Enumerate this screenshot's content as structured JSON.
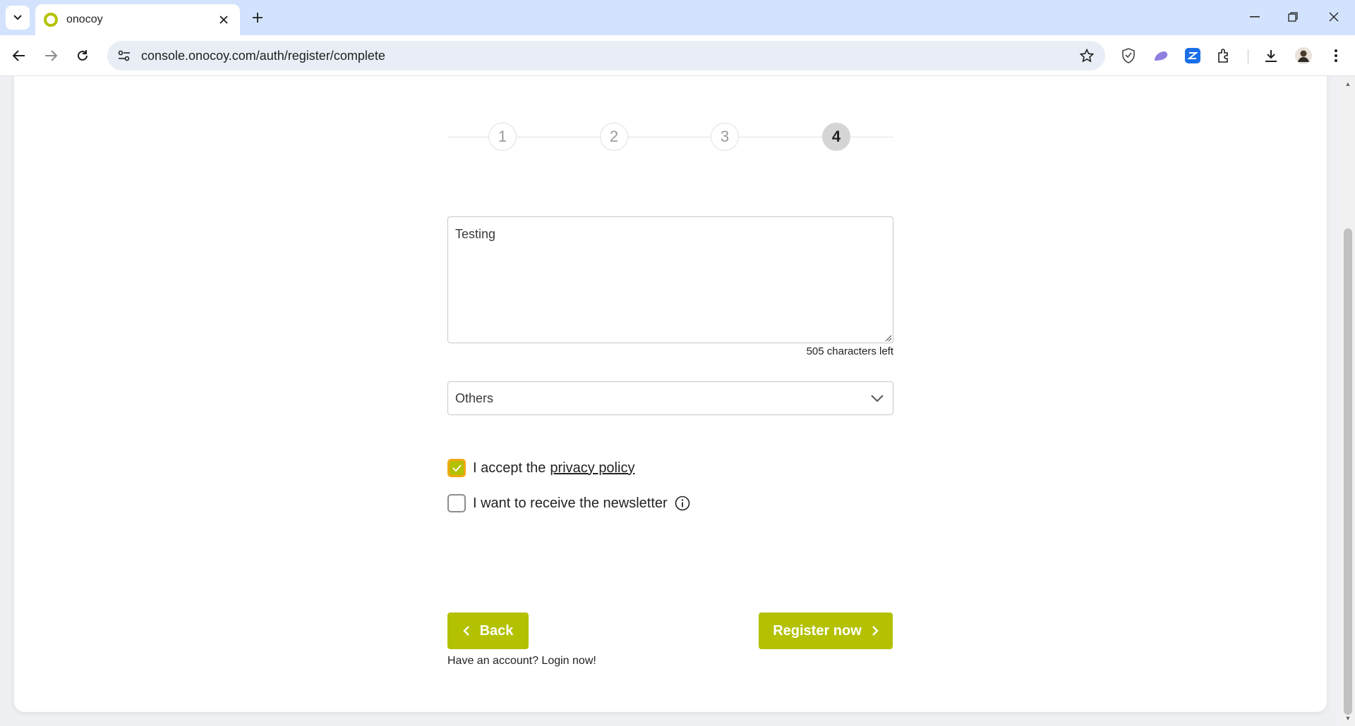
{
  "browser": {
    "tab": {
      "title": "onocoy"
    },
    "url": "console.onocoy.com/auth/register/complete"
  },
  "stepper": {
    "steps": [
      "1",
      "2",
      "3",
      "4"
    ],
    "active_step": 4
  },
  "form": {
    "description": {
      "value": "Testing",
      "counter": "505 characters left"
    },
    "category_select": {
      "selected": "Others"
    },
    "privacy": {
      "text": "I accept the",
      "link_text": "privacy policy",
      "checked": true
    },
    "newsletter": {
      "text": "I want to receive the newsletter",
      "checked": false
    }
  },
  "buttons": {
    "back": "Back",
    "register": "Register now"
  },
  "footer": {
    "login_text": "Have an account? Login now!"
  },
  "colors": {
    "accent": "#b3c100",
    "focus": "#f3a712",
    "tabstrip": "#d3e3fd"
  }
}
